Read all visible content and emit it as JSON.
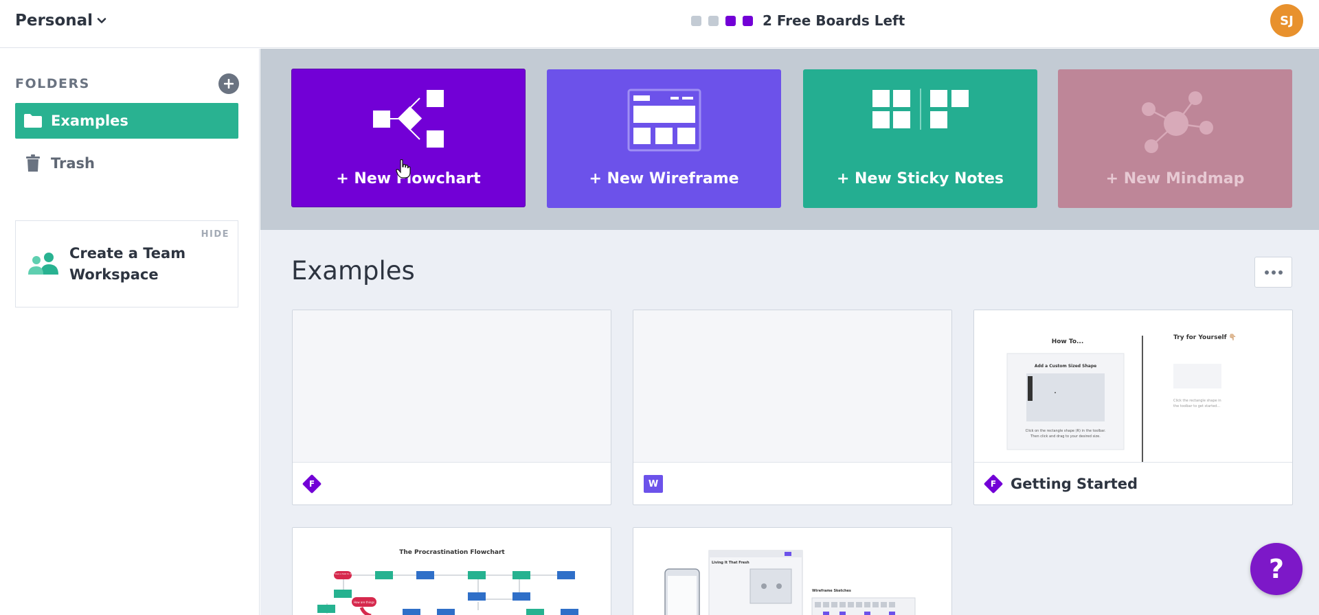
{
  "header": {
    "workspace_label": "Personal",
    "boards_left_text": "2 Free Boards Left",
    "board_slots": [
      {
        "state": "unused",
        "color": "#c3cbd4"
      },
      {
        "state": "unused",
        "color": "#c3cbd4"
      },
      {
        "state": "used",
        "color": "#7200d6"
      },
      {
        "state": "used",
        "color": "#7200d6"
      }
    ],
    "avatar_initials": "SJ",
    "avatar_color": "#e8912d"
  },
  "sidebar": {
    "folders_label": "FOLDERS",
    "items": [
      {
        "label": "Examples",
        "icon": "folder-icon",
        "active": true
      },
      {
        "label": "Trash",
        "icon": "trash-icon",
        "active": false
      }
    ],
    "team_card": {
      "hide_label": "HIDE",
      "text": "Create a Team Workspace",
      "icon": "team-icon"
    }
  },
  "new_tiles": [
    {
      "label": "+ New Flowchart",
      "icon": "flowchart-icon",
      "color": "#7200d6"
    },
    {
      "label": "+ New Wireframe",
      "icon": "wireframe-icon",
      "color": "#6c52ea"
    },
    {
      "label": "+ New Sticky Notes",
      "icon": "sticky-notes-icon",
      "color": "#24ae91"
    },
    {
      "label": "+ New Mindmap",
      "icon": "mindmap-icon",
      "color": "#be8698"
    }
  ],
  "main": {
    "section_title": "Examples",
    "boards": [
      {
        "name": "",
        "type_badge": "F"
      },
      {
        "name": "",
        "type_badge": "W"
      },
      {
        "name": "Getting Started",
        "type_badge": "F",
        "thumb": {
          "left_heading": "How To...",
          "right_heading": "Try for Yourself 👇🏼",
          "card_title": "Add a Custom Sized Shape",
          "card_caption_1": "Click on the rectangle shape (R) in the toolbar.",
          "card_caption_2": "Then click and drag to your desired size.",
          "right_caption_1": "Click the rectangle shape in",
          "right_caption_2": "the toolbar to get started..."
        }
      },
      {
        "name": "",
        "type_badge": "",
        "thumb": {
          "title": "The Procrastination Flowchart",
          "bubble_1": "I have a task to do",
          "bubble_2": "How are things"
        }
      },
      {
        "name": "",
        "type_badge": "",
        "thumb": {
          "label_1": "Living It That Fresh",
          "label_2": "Wireframe Sketches"
        }
      }
    ]
  },
  "help_label": "?"
}
